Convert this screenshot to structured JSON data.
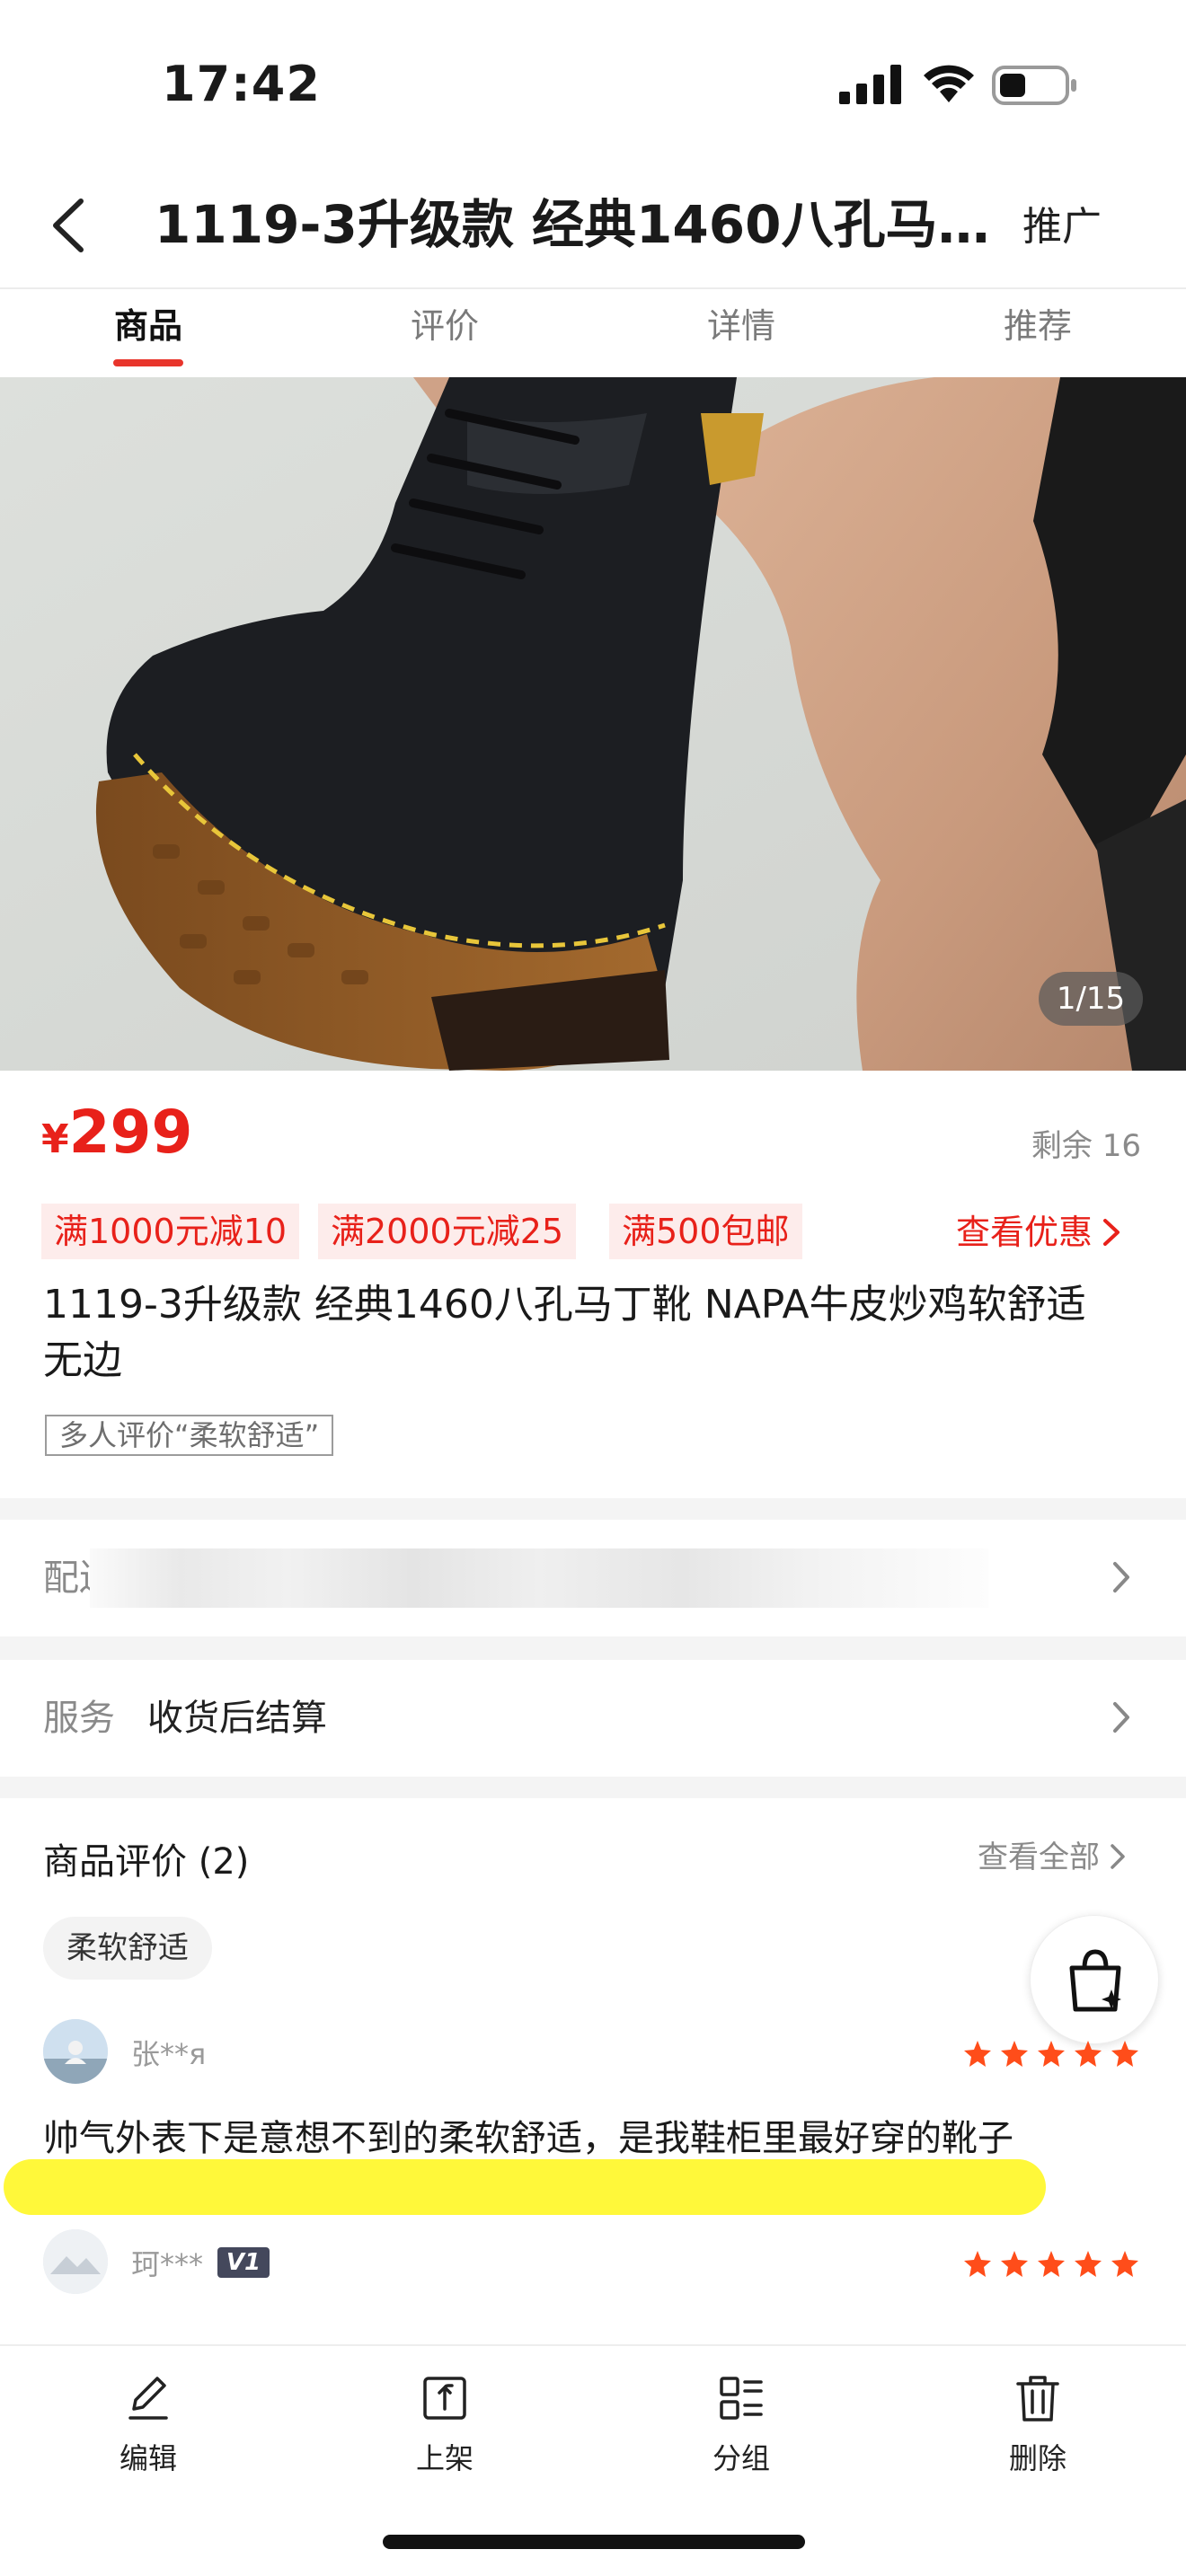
{
  "status_bar": {
    "time": "17:42",
    "icons": [
      "signal-icon",
      "wifi-icon",
      "battery-icon"
    ]
  },
  "nav": {
    "back_icon": "chevron-left-icon",
    "title": "1119-3升级款 经典1460八孔马丁靴 NAPA牛皮炒鸡软舒适无边",
    "right": "推广"
  },
  "tabs": [
    {
      "label": "商品",
      "active": true
    },
    {
      "label": "评价",
      "active": false
    },
    {
      "label": "详情",
      "active": false
    },
    {
      "label": "推荐",
      "active": false
    }
  ],
  "gallery": {
    "counter": "1/15",
    "current_index": 1,
    "total": 15
  },
  "price": {
    "currency": "¥",
    "value": "299"
  },
  "stock": "剩余 16",
  "coupons": [
    "满1000元减10",
    "满2000元减25",
    "满500包邮"
  ],
  "coupon_link": "查看优惠",
  "product_title": "1119-3升级款 经典1460八孔马丁靴 NAPA牛皮炒鸡软舒适无边",
  "review_tag": "多人评价“柔软舒适”",
  "delivery": {
    "label": "配送"
  },
  "service": {
    "label": "服务",
    "value": "收货后结算"
  },
  "reviews": {
    "title": "商品评价 (2)",
    "view_all": "查看全部",
    "keyword": "柔软舒适",
    "items": [
      {
        "name": "张**я",
        "stars": 5,
        "text": "帅气外表下是意想不到的柔软舒适，是我鞋柜里最好穿的靴子"
      },
      {
        "name": "珂***",
        "badge": "V1",
        "stars": 5
      }
    ]
  },
  "toolbar": [
    {
      "label": "编辑",
      "icon": "pencil-icon"
    },
    {
      "label": "上架",
      "icon": "upload-icon"
    },
    {
      "label": "分组",
      "icon": "group-icon"
    },
    {
      "label": "删除",
      "icon": "trash-icon"
    }
  ],
  "colors": {
    "accent": "#e8211a",
    "coupon_bg": "#fdeceb",
    "star": "#ff4d1a",
    "highlight": "#fff83a"
  }
}
